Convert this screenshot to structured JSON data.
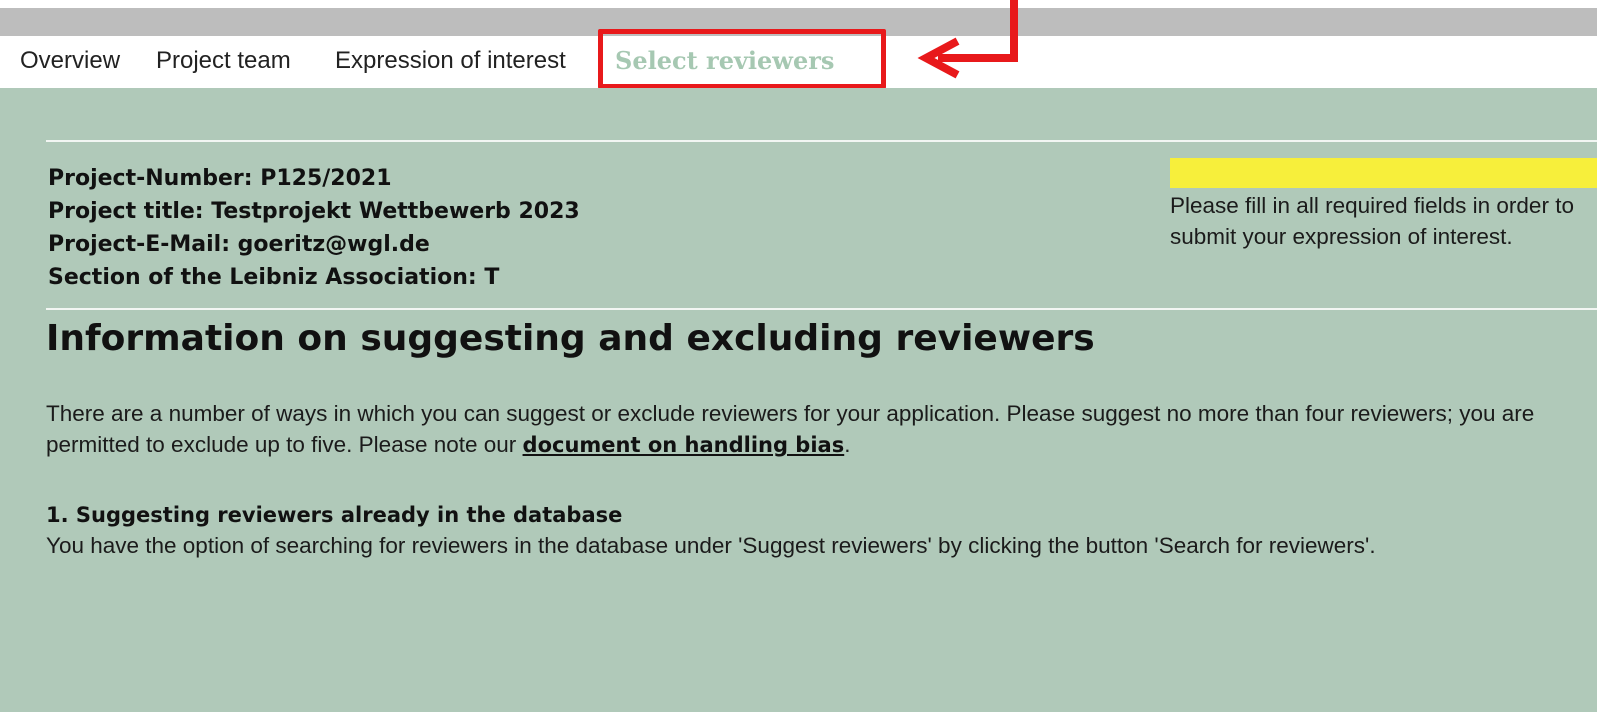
{
  "nav": {
    "tabs": [
      {
        "label": "Overview"
      },
      {
        "label": "Project team"
      },
      {
        "label": "Expression of interest"
      },
      {
        "label": "Select reviewers"
      }
    ]
  },
  "project": {
    "number": "Project-Number: P125/2021",
    "title": "Project title: Testprojekt Wettbewerb 2023",
    "email": "Project-E-Mail: goeritz@wgl.de",
    "section": "Section of the Leibniz Association: T"
  },
  "notice": {
    "text": "Please fill in all required fields in order to submit your expression of interest."
  },
  "content": {
    "heading": "Information on suggesting and excluding reviewers",
    "intro_text": "There are a number of ways in which you can suggest or exclude reviewers for your application. Please suggest no more than four reviewers; you are permitted to exclude up to five. Please note our ",
    "bias_link": "document on handling bias",
    "intro_end": ".",
    "section1_title": "1. Suggesting reviewers already in the database",
    "section1_text": "You have the option of searching for reviewers in the database under 'Suggest reviewers' by clicking the button 'Search for reviewers'."
  },
  "colors": {
    "background": "#b0c9b9",
    "active_tab": "#a6c8b2",
    "highlight": "#e8191b",
    "notice_bar": "#f7ef3b"
  }
}
